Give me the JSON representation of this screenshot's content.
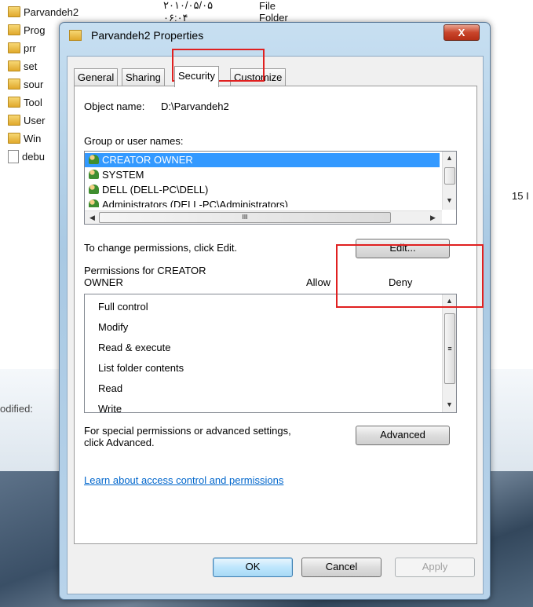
{
  "background": {
    "rows": [
      {
        "name": "Parvandeh2",
        "date": "۲۰۱۰/۰۵/۰۵ ۰۶:۰۴",
        "type": "File Folder",
        "icon": "folder-icon"
      },
      {
        "name": "Prog",
        "icon": "folder-icon"
      },
      {
        "name": "prr",
        "icon": "folder-icon"
      },
      {
        "name": "set",
        "icon": "folder-icon"
      },
      {
        "name": "sour",
        "icon": "folder-icon"
      },
      {
        "name": "Tool",
        "icon": "folder-icon"
      },
      {
        "name": "User",
        "icon": "folder-icon"
      },
      {
        "name": "Win",
        "icon": "folder-icon"
      },
      {
        "name": "debu",
        "icon": "file-icon"
      }
    ],
    "size_partial": "15 I",
    "modified_label": "odified:"
  },
  "dialog": {
    "title": "Parvandeh2 Properties",
    "close": "X",
    "tabs": [
      {
        "label": "General",
        "active": false
      },
      {
        "label": "Sharing",
        "active": false
      },
      {
        "label": "Security",
        "active": true
      },
      {
        "label": "Customize",
        "active": false
      }
    ],
    "object_label": "Object name:",
    "object_value": "D:\\Parvandeh2",
    "group_label": "Group or user names:",
    "users": [
      {
        "label": "CREATOR OWNER",
        "selected": true,
        "icon": "users-group-icon"
      },
      {
        "label": "SYSTEM",
        "selected": false,
        "icon": "users-group-icon"
      },
      {
        "label": "DELL (DELL-PC\\DELL)",
        "selected": false,
        "icon": "user-icon"
      },
      {
        "label": "Administrators (DELL-PC\\Administrators)",
        "selected": false,
        "icon": "users-group-icon"
      }
    ],
    "hscroll_grip": "III",
    "change_text": "To change permissions, click Edit.",
    "edit_button": "Edit...",
    "perm_for_line1": "Permissions for CREATOR",
    "perm_for_line2": "OWNER",
    "allow_header": "Allow",
    "deny_header": "Deny",
    "permissions": [
      "Full control",
      "Modify",
      "Read & execute",
      "List folder contents",
      "Read",
      "Write"
    ],
    "special_text_line1": "For special permissions or advanced settings,",
    "special_text_line2": "click Advanced.",
    "advanced_button": "Advanced",
    "learn_link": "Learn about access control and permissions",
    "ok_button": "OK",
    "cancel_button": "Cancel",
    "apply_button": "Apply"
  },
  "colors": {
    "selection": "#3399ff",
    "highlight_box": "#e02020",
    "link": "#0066cc"
  }
}
